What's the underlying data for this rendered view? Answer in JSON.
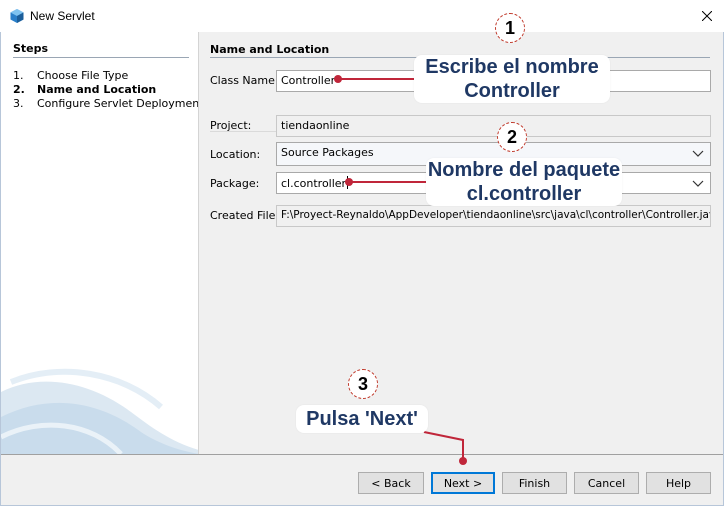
{
  "window": {
    "title": "New Servlet",
    "close_icon": "close-icon",
    "app_icon": "netbeans-icon"
  },
  "steps": {
    "heading": "Steps",
    "items": [
      {
        "num": "1.",
        "label": "Choose File Type"
      },
      {
        "num": "2.",
        "label": "Name and Location"
      },
      {
        "num": "3.",
        "label": "Configure Servlet Deployment"
      }
    ]
  },
  "form": {
    "heading": "Name and Location",
    "class_name": {
      "label": "Class Name:",
      "value": "Controller"
    },
    "project": {
      "label": "Project:",
      "value": "tiendaonline"
    },
    "location": {
      "label": "Location:",
      "value": "Source Packages"
    },
    "package": {
      "label": "Package:",
      "value": "cl.controller"
    },
    "created_file": {
      "label": "Created File:",
      "value": "F:\\Proyect-Reynaldo\\AppDeveloper\\tiendaonline\\src\\java\\cl\\controller\\Controller.java"
    }
  },
  "buttons": {
    "back": "< Back",
    "next": "Next >",
    "finish": "Finish",
    "cancel": "Cancel",
    "help": "Help"
  },
  "annotations": {
    "step1": {
      "badge": "1",
      "line1": "Escribe el nombre",
      "line2": "Controller"
    },
    "step2": {
      "badge": "2",
      "line1": "Nombre del paquete",
      "line2": "cl.controller"
    },
    "step3": {
      "badge": "3",
      "line1": "Pulsa 'Next'"
    }
  },
  "colors": {
    "annotation_text": "#1f3864",
    "annotation_line": "#c0263a",
    "accent": "#0078d7"
  }
}
